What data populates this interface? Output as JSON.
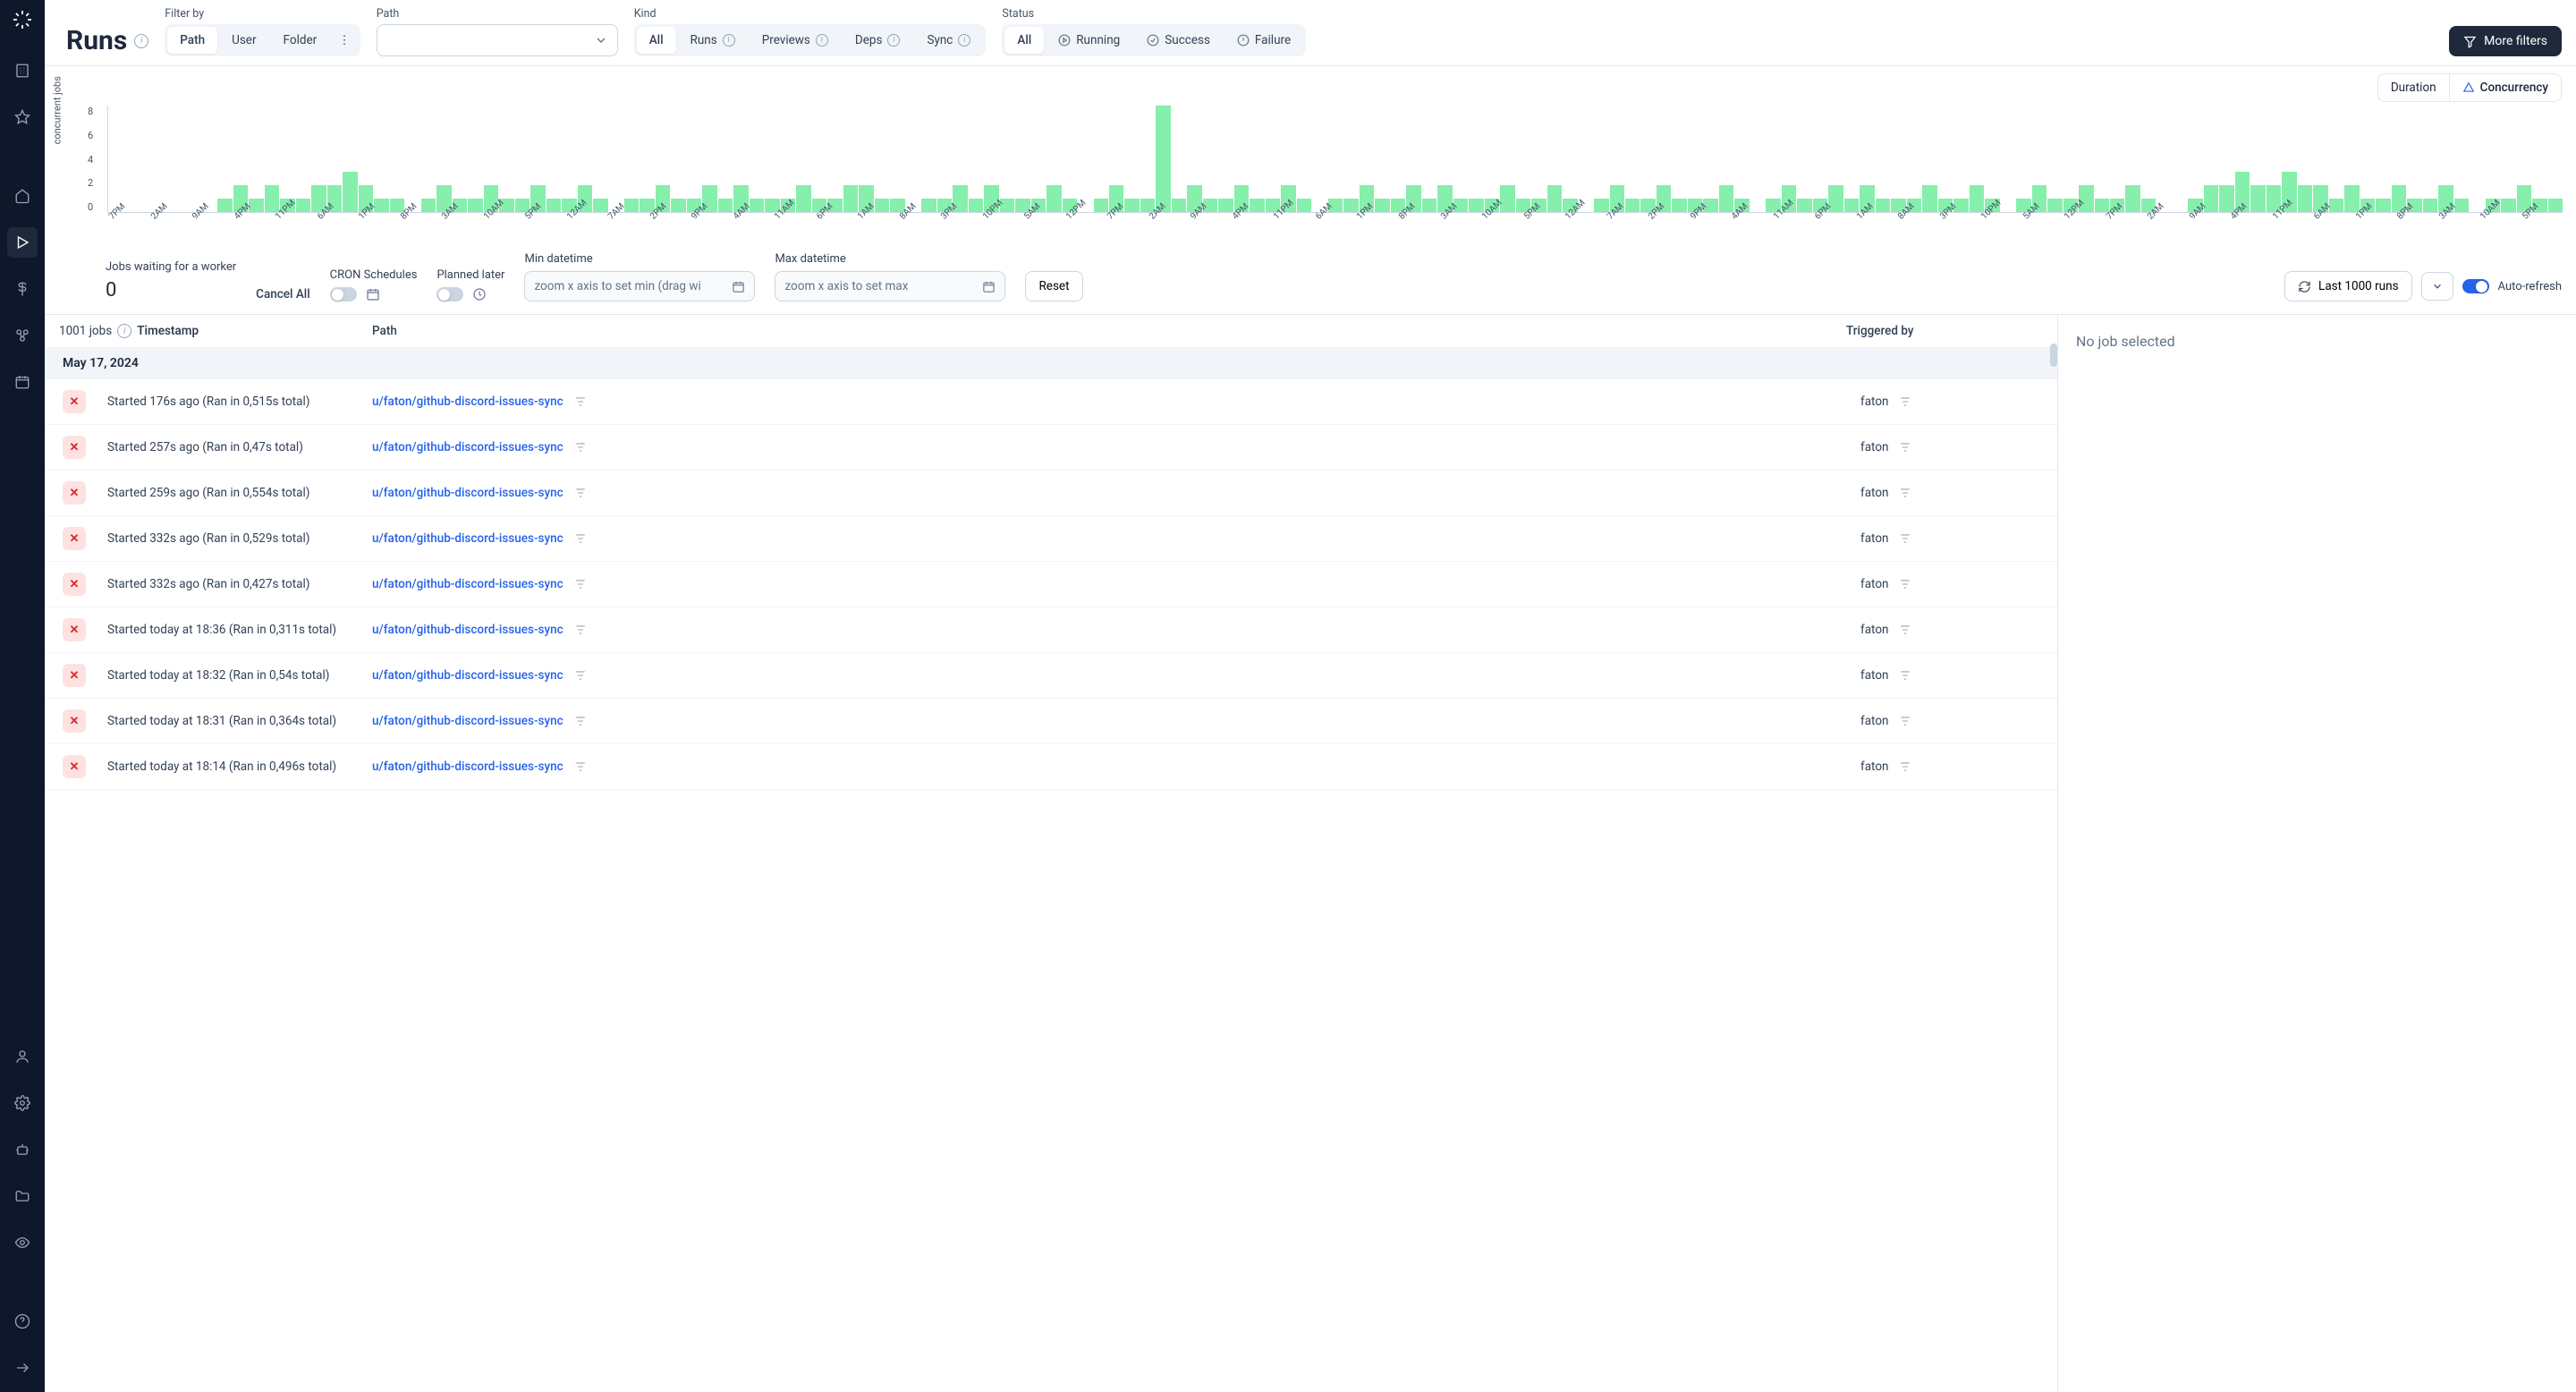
{
  "page": {
    "title": "Runs"
  },
  "filters": {
    "filter_by_label": "Filter by",
    "filter_by": [
      "Path",
      "User",
      "Folder"
    ],
    "filter_by_active": "Path",
    "path_label": "Path",
    "kind_label": "Kind",
    "kind": [
      {
        "label": "All"
      },
      {
        "label": "Runs",
        "info": true
      },
      {
        "label": "Previews",
        "info": true
      },
      {
        "label": "Deps",
        "info": true
      },
      {
        "label": "Sync",
        "info": true
      }
    ],
    "kind_active": "All",
    "status_label": "Status",
    "status": [
      {
        "label": "All"
      },
      {
        "label": "Running",
        "icon": "play-circle"
      },
      {
        "label": "Success",
        "icon": "check-circle"
      },
      {
        "label": "Failure",
        "icon": "alert-circle"
      }
    ],
    "status_active": "All",
    "more_filters": "More filters"
  },
  "chart_tabs": {
    "duration": "Duration",
    "concurrency": "Concurrency",
    "active": "Concurrency"
  },
  "chart_data": {
    "type": "bar",
    "ylabel": "concurrent jobs",
    "ylim": [
      0,
      8
    ],
    "y_ticks": [
      8,
      6,
      4,
      2,
      0
    ],
    "x_ticks": [
      "7PM",
      "2AM",
      "9AM",
      "4PM",
      "11PM",
      "6AM",
      "1PM",
      "8PM",
      "3AM",
      "10AM",
      "5PM",
      "12AM",
      "7AM",
      "2PM",
      "9PM",
      "4AM",
      "11AM",
      "6PM",
      "1AM",
      "8AM",
      "3PM",
      "10PM",
      "5AM",
      "12PM",
      "7PM",
      "2AM",
      "9AM",
      "4PM",
      "11PM",
      "6AM",
      "1PM",
      "8PM",
      "3AM",
      "10AM",
      "5PM",
      "12AM",
      "7AM",
      "2PM",
      "9PM",
      "4AM",
      "11AM",
      "6PM",
      "1AM",
      "8AM",
      "3PM",
      "10PM",
      "5AM",
      "12PM",
      "7PM",
      "2AM",
      "9AM",
      "4PM",
      "11PM",
      "6AM",
      "1PM",
      "8PM",
      "3AM",
      "10AM",
      "5PM"
    ],
    "values": [
      0,
      0,
      0,
      0,
      0,
      0,
      0,
      1,
      2,
      1,
      2,
      1,
      1,
      2,
      2,
      3,
      2,
      1,
      1,
      0,
      1,
      2,
      1,
      1,
      2,
      1,
      1,
      2,
      1,
      1,
      2,
      1,
      0,
      1,
      1,
      2,
      1,
      1,
      2,
      1,
      2,
      1,
      1,
      1,
      2,
      1,
      1,
      2,
      2,
      1,
      1,
      0,
      1,
      1,
      2,
      1,
      2,
      1,
      1,
      1,
      2,
      1,
      0,
      1,
      2,
      1,
      1,
      8,
      1,
      2,
      1,
      1,
      2,
      1,
      1,
      2,
      1,
      0,
      1,
      1,
      2,
      1,
      1,
      2,
      1,
      2,
      1,
      1,
      1,
      2,
      1,
      1,
      2,
      1,
      0,
      1,
      2,
      1,
      1,
      2,
      1,
      1,
      1,
      2,
      1,
      0,
      1,
      2,
      1,
      1,
      2,
      1,
      2,
      1,
      1,
      1,
      2,
      1,
      1,
      2,
      1,
      0,
      1,
      2,
      1,
      1,
      2,
      1,
      1,
      2,
      1,
      0,
      0,
      1,
      2,
      2,
      3,
      2,
      2,
      3,
      2,
      2,
      1,
      2,
      1,
      1,
      2,
      1,
      1,
      2,
      1,
      0,
      1,
      1,
      2,
      1,
      1
    ]
  },
  "controls": {
    "jobs_waiting_label": "Jobs waiting for a worker",
    "jobs_waiting": "0",
    "cancel_all": "Cancel All",
    "cron_label": "CRON Schedules",
    "planned_label": "Planned later",
    "min_dt_label": "Min datetime",
    "min_dt_placeholder": "zoom x axis to set min (drag wi",
    "max_dt_label": "Max datetime",
    "max_dt_placeholder": "zoom x axis to set max",
    "reset": "Reset",
    "last_runs": "Last 1000 runs",
    "auto_refresh": "Auto-refresh"
  },
  "table": {
    "jobs_count": "1001 jobs",
    "col_timestamp": "Timestamp",
    "col_path": "Path",
    "col_triggered": "Triggered by",
    "date_header": "May 17, 2024",
    "rows": [
      {
        "ts": "Started 176s ago (Ran in 0,515s total)",
        "path": "u/faton/github-discord-issues-sync",
        "user": "faton"
      },
      {
        "ts": "Started 257s ago (Ran in 0,47s total)",
        "path": "u/faton/github-discord-issues-sync",
        "user": "faton"
      },
      {
        "ts": "Started 259s ago (Ran in 0,554s total)",
        "path": "u/faton/github-discord-issues-sync",
        "user": "faton"
      },
      {
        "ts": "Started 332s ago (Ran in 0,529s total)",
        "path": "u/faton/github-discord-issues-sync",
        "user": "faton"
      },
      {
        "ts": "Started 332s ago (Ran in 0,427s total)",
        "path": "u/faton/github-discord-issues-sync",
        "user": "faton"
      },
      {
        "ts": "Started today at 18:36 (Ran in 0,311s total)",
        "path": "u/faton/github-discord-issues-sync",
        "user": "faton"
      },
      {
        "ts": "Started today at 18:32 (Ran in 0,54s total)",
        "path": "u/faton/github-discord-issues-sync",
        "user": "faton"
      },
      {
        "ts": "Started today at 18:31 (Ran in 0,364s total)",
        "path": "u/faton/github-discord-issues-sync",
        "user": "faton"
      },
      {
        "ts": "Started today at 18:14 (Ran in 0,496s total)",
        "path": "u/faton/github-discord-issues-sync",
        "user": "faton"
      }
    ]
  },
  "detail": {
    "empty": "No job selected"
  }
}
